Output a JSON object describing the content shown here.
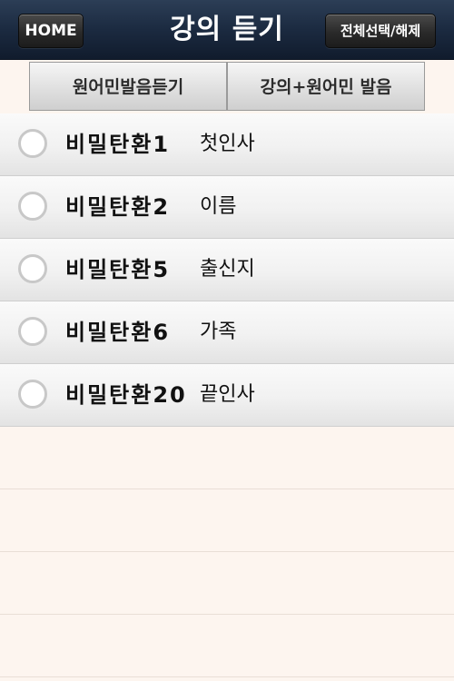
{
  "navbar": {
    "title": "강의 듣기",
    "home_label": "HOME",
    "select_all_label": "전체선택/해제"
  },
  "segments": [
    {
      "label": "원어민발음듣기"
    },
    {
      "label": "강의+원어민 발음"
    }
  ],
  "lessons": [
    {
      "name": "비밀탄환1",
      "topic": "첫인사"
    },
    {
      "name": "비밀탄환2",
      "topic": "이름"
    },
    {
      "name": "비밀탄환5",
      "topic": "출신지"
    },
    {
      "name": "비밀탄환6",
      "topic": "가족"
    },
    {
      "name": "비밀탄환20",
      "topic": "끝인사"
    }
  ],
  "colors": {
    "navbar": "#1b2a40",
    "background": "#fdf5ef",
    "radio_border": "#c8c8c8"
  }
}
